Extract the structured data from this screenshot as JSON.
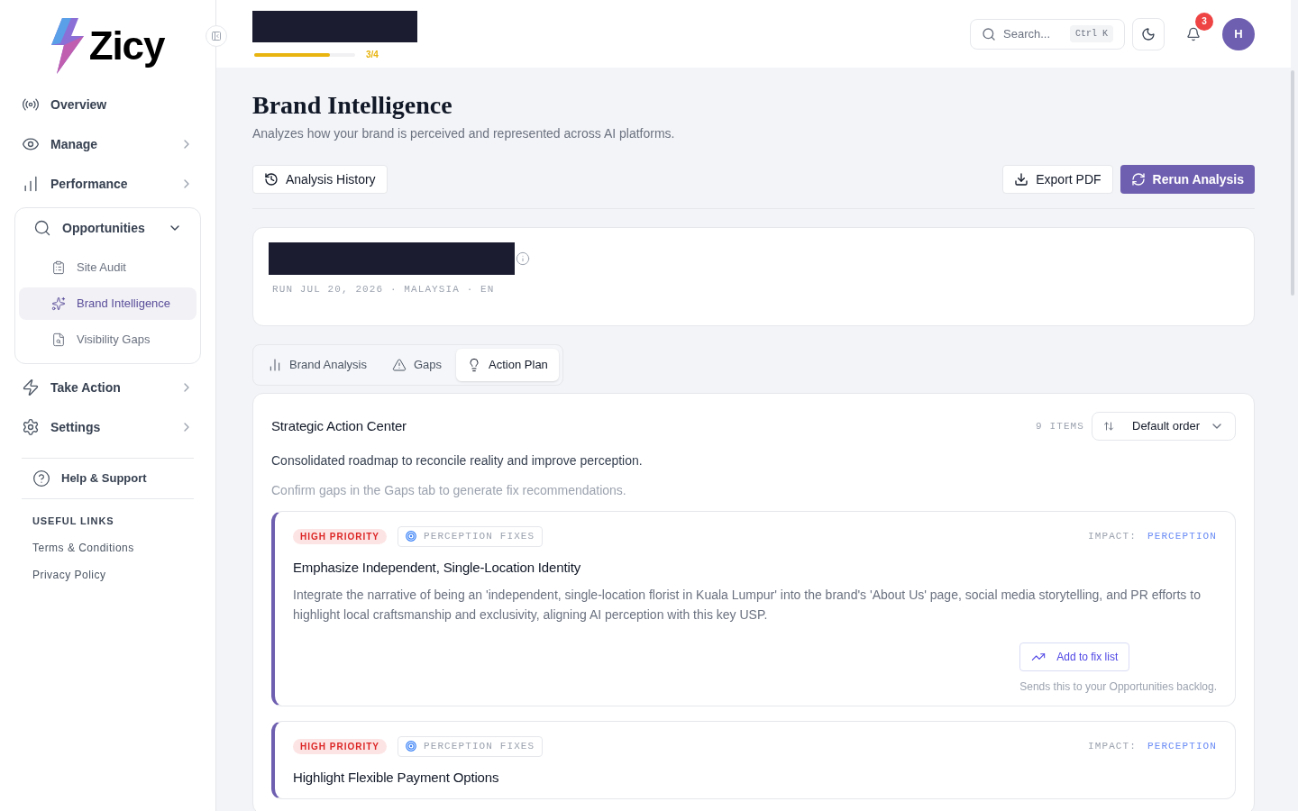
{
  "brand": {
    "name": "Zicy"
  },
  "sidebar": {
    "items": [
      {
        "label": "Overview",
        "kind": "link"
      },
      {
        "label": "Manage",
        "kind": "group",
        "expanded": false
      },
      {
        "label": "Performance",
        "kind": "group",
        "expanded": false
      },
      {
        "label": "Opportunities",
        "kind": "group",
        "expanded": true,
        "children": [
          {
            "label": "Site Audit",
            "selected": false
          },
          {
            "label": "Brand Intelligence",
            "selected": true
          },
          {
            "label": "Visibility Gaps",
            "selected": false
          }
        ]
      },
      {
        "label": "Take Action",
        "kind": "group",
        "expanded": false
      },
      {
        "label": "Settings",
        "kind": "group",
        "expanded": false
      }
    ],
    "help": "Help & Support",
    "links_heading": "USEFUL LINKS",
    "links": [
      "Terms & Conditions",
      "Privacy Policy"
    ]
  },
  "header": {
    "progress": {
      "level": 0.75,
      "reading": "3/4"
    },
    "search": {
      "placeholder": "Search...",
      "shortcut": "Ctrl K"
    },
    "notifications": "3",
    "avatar": "H"
  },
  "page": {
    "title": "Brand Intelligence",
    "subtitle": "Analyzes how your brand is perceived and represented across AI platforms.",
    "history_button": "Analysis History",
    "export_button": "Export PDF",
    "rerun_button": "Rerun Analysis"
  },
  "summary": {
    "meta": "RUN JUL 20, 2026 · MALAYSIA · EN"
  },
  "tabs": [
    {
      "label": "Brand Analysis",
      "selected": false
    },
    {
      "label": "Gaps",
      "selected": false
    },
    {
      "label": "Action Plan",
      "selected": true
    }
  ],
  "action_center": {
    "title": "Strategic Action Center",
    "count": "9 ITEMS",
    "sort": "Default order",
    "description": "Consolidated roadmap to reconcile reality and improve perception.",
    "hint": "Confirm gaps in the Gaps tab to generate fix recommendations.",
    "cards": [
      {
        "priority": "HIGH PRIORITY",
        "color": "#dc2626",
        "category": "PERCEPTION FIXES",
        "impact_label": "IMPACT:",
        "impact": "PERCEPTION",
        "title": "Emphasize Independent, Single-Location Identity",
        "description": "Integrate the narrative of being an 'independent, single-location florist in Kuala Lumpur' into the brand's 'About Us' page, social media storytelling, and PR efforts to highlight local craftsmanship and exclusivity, aligning AI perception with this key USP.",
        "button": "Add to fix list",
        "note": "Sends this to your Opportunities backlog."
      },
      {
        "priority": "HIGH PRIORITY",
        "color": "#dc2626",
        "category": "PERCEPTION FIXES",
        "impact_label": "IMPACT:",
        "impact": "PERCEPTION",
        "title": "Highlight Flexible Payment Options"
      }
    ]
  }
}
